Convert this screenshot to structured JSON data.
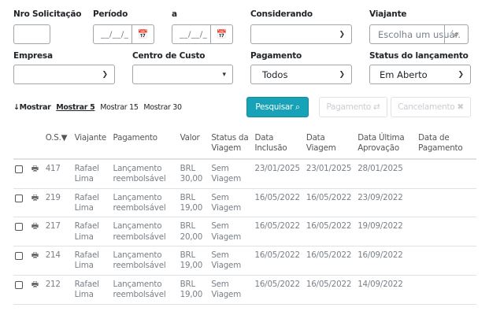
{
  "filters": {
    "nro_solicitacao_label": "Nro Solicitação",
    "periodo_label": "Período",
    "a_label": "a",
    "considerando_label": "Considerando",
    "viajante_label": "Viajante",
    "viajante_placeholder": "Escolha um usuár.",
    "date_placeholder": "__/__/_",
    "empresa_label": "Empresa",
    "centro_custo_label": "Centro de Custo",
    "pagamento_label": "Pagamento",
    "pagamento_value": "Todos",
    "status_label": "Status do lançamento",
    "status_value": "Em Aberto"
  },
  "show": {
    "prefix": "Mostrar",
    "options": [
      "Mostrar 5",
      "Mostrar 15",
      "Mostrar 30"
    ],
    "current": "Mostrar 5"
  },
  "actions": {
    "pesquisar": "Pesquisar",
    "pagamento": "Pagamento",
    "cancelamento": "Cancelamento"
  },
  "table": {
    "headers": [
      "O.S.",
      "Viajante",
      "Pagamento",
      "Valor",
      "Status da Viagem",
      "Data Inclusão",
      "Data Viagem",
      "Data Última Aprovação",
      "Data de Pagamento"
    ],
    "rows": [
      {
        "os": "417",
        "viajante": "Rafael Lima",
        "pagamento": "Lançamento reembolsável",
        "valor": "BRL 30,00",
        "status": "Sem Viagem",
        "inclusao": "23/01/2025",
        "viagem": "23/01/2025",
        "aprovacao": "28/01/2025",
        "data_pagamento": ""
      },
      {
        "os": "219",
        "viajante": "Rafael Lima",
        "pagamento": "Lançamento reembolsável",
        "valor": "BRL 19,00",
        "status": "Sem Viagem",
        "inclusao": "16/05/2022",
        "viagem": "16/05/2022",
        "aprovacao": "23/09/2022",
        "data_pagamento": ""
      },
      {
        "os": "217",
        "viajante": "Rafael Lima",
        "pagamento": "Lançamento reembolsável",
        "valor": "BRL 20,00",
        "status": "Sem Viagem",
        "inclusao": "16/05/2022",
        "viagem": "16/05/2022",
        "aprovacao": "19/09/2022",
        "data_pagamento": ""
      },
      {
        "os": "214",
        "viajante": "Rafael Lima",
        "pagamento": "Lançamento reembolsável",
        "valor": "BRL 19,00",
        "status": "Sem Viagem",
        "inclusao": "16/05/2022",
        "viagem": "16/05/2022",
        "aprovacao": "16/09/2022",
        "data_pagamento": ""
      },
      {
        "os": "212",
        "viajante": "Rafael Lima",
        "pagamento": "Lançamento reembolsável",
        "valor": "BRL 19,00",
        "status": "Sem Viagem",
        "inclusao": "16/05/2022",
        "viagem": "16/05/2022",
        "aprovacao": "14/09/2022",
        "data_pagamento": ""
      }
    ]
  },
  "icons": {
    "calendar": "calendar-icon",
    "search": "search-icon",
    "print": "print-icon",
    "sort": "sort-down-icon",
    "chevron": "chevron-down-icon"
  },
  "colors": {
    "primary": "#17a2b8",
    "border": "#9ea5ab"
  }
}
